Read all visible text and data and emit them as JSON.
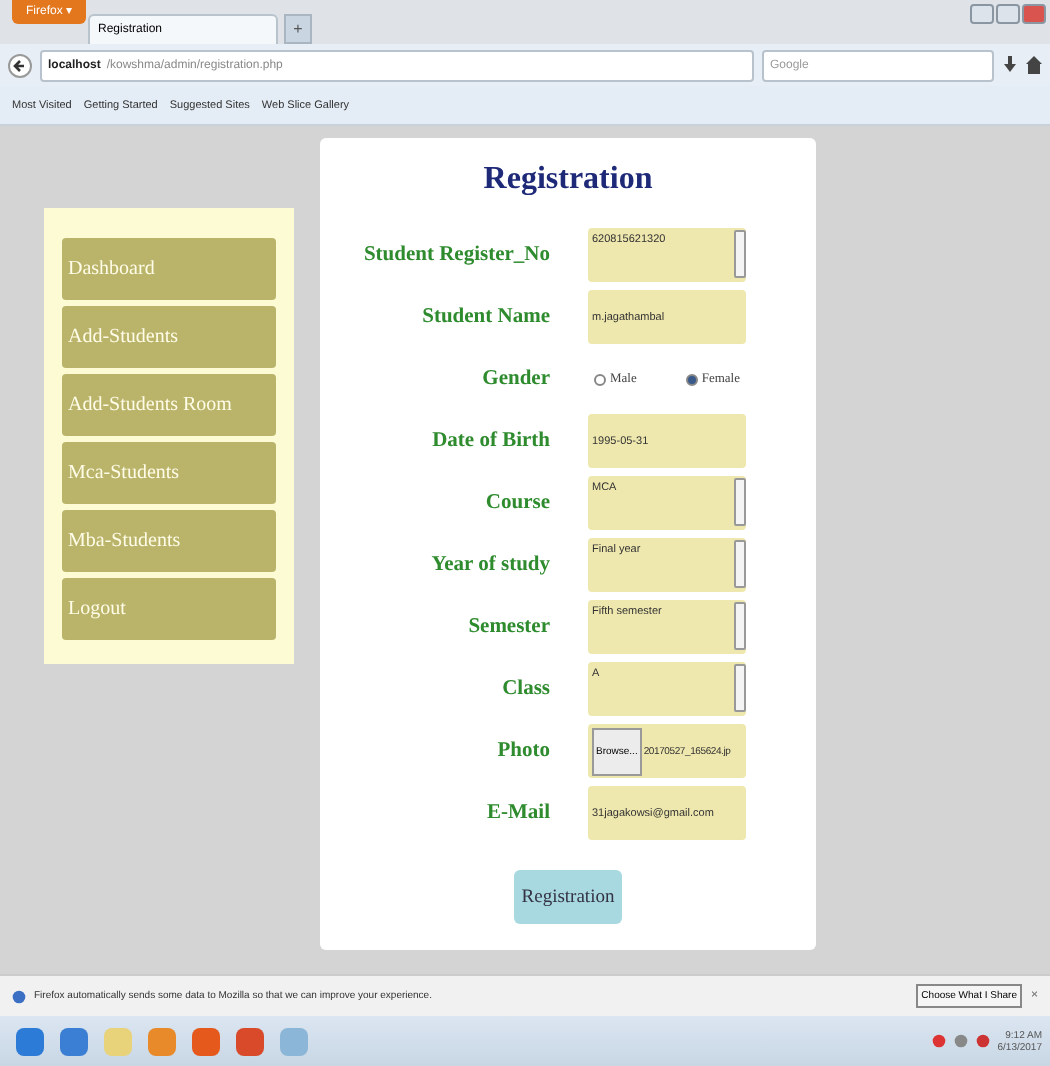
{
  "browser": {
    "menu_button": "Firefox ▾",
    "tab": "Registration",
    "new_tab": "+",
    "url_host": "localhost",
    "url_path": "/kowshma/admin/registration.php",
    "search_placeholder": "Google",
    "bookmarks": [
      "Most Visited",
      "Getting Started",
      "Suggested Sites",
      "Web Slice Gallery"
    ]
  },
  "sidebar": {
    "items": [
      {
        "label": "Dashboard"
      },
      {
        "label": "Add-Students"
      },
      {
        "label": "Add-Students Room"
      },
      {
        "label": "Mca-Students"
      },
      {
        "label": "Mba-Students"
      },
      {
        "label": "Logout"
      }
    ]
  },
  "form": {
    "title": "Registration",
    "rows": [
      {
        "kind": "select",
        "label": "Student Register_No",
        "value": "620815621320"
      },
      {
        "kind": "text",
        "label": "Student Name",
        "value": "m.jagathambal"
      },
      {
        "kind": "radio",
        "label": "Gender",
        "options": [
          {
            "label": "Male",
            "selected": false
          },
          {
            "label": "Female",
            "selected": true
          }
        ]
      },
      {
        "kind": "text",
        "label": "Date of Birth",
        "value": "1995-05-31"
      },
      {
        "kind": "select",
        "label": "Course",
        "value": "MCA"
      },
      {
        "kind": "select",
        "label": "Year of study",
        "value": "Final year"
      },
      {
        "kind": "select",
        "label": "Semester",
        "value": "Fifth semester"
      },
      {
        "kind": "select",
        "label": "Class",
        "value": "A"
      },
      {
        "kind": "file",
        "label": "Photo",
        "button": "Browse...",
        "value": "20170527_165624.jp"
      },
      {
        "kind": "text",
        "label": "E-Mail",
        "value": "31jagakowsi@gmail.com"
      }
    ],
    "submit": "Registration"
  },
  "notification": {
    "text": "Firefox automatically sends some data to Mozilla so that we can improve your experience.",
    "button": "Choose What I Share",
    "close": "×"
  },
  "taskbar": {
    "time": "9:12 AM",
    "date": "6/13/2017"
  }
}
